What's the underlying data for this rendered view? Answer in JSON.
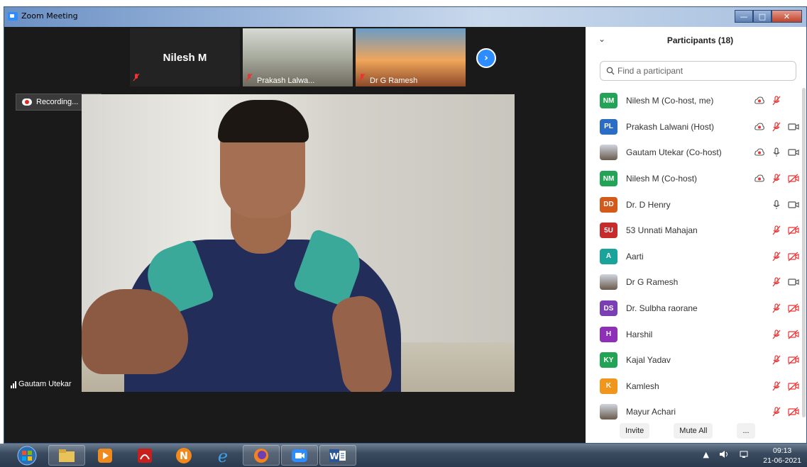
{
  "window": {
    "title": "Zoom Meeting",
    "minimize": "—",
    "maximize": "□",
    "close": "✕"
  },
  "stage": {
    "thumbnails": [
      {
        "big_name": "Nilesh M",
        "label": ""
      },
      {
        "label": "Prakash Lalwa..."
      },
      {
        "label": "Dr G Ramesh"
      }
    ],
    "next_icon": "›",
    "recording": "Recording...",
    "active_speaker": "Gautam Utekar"
  },
  "panel": {
    "collapse_icon": "⌄",
    "title": "Participants (18)",
    "search_placeholder": "Find a participant",
    "participants": [
      {
        "initials": "NM",
        "color": "#23a356",
        "name": "Nilesh M (Co-host, me)",
        "rec": true,
        "mic": "muted",
        "video": "none"
      },
      {
        "initials": "PL",
        "color": "#2b6cc4",
        "name": "Prakash Lalwani (Host)",
        "rec": true,
        "mic": "muted",
        "video": "on"
      },
      {
        "initials": "",
        "color": "#dfe8f0",
        "name": "Gautam Utekar (Co-host)",
        "rec": true,
        "mic": "on",
        "video": "on",
        "photo": true
      },
      {
        "initials": "NM",
        "color": "#23a356",
        "name": "Nilesh M (Co-host)",
        "rec": true,
        "mic": "muted",
        "video": "off"
      },
      {
        "initials": "DD",
        "color": "#d45a1c",
        "name": "Dr. D Henry",
        "rec": false,
        "mic": "on",
        "video": "on"
      },
      {
        "initials": "5U",
        "color": "#c62c2c",
        "name": "53 Unnati Mahajan",
        "rec": false,
        "mic": "muted",
        "video": "off"
      },
      {
        "initials": "A",
        "color": "#1aa39a",
        "name": "Aarti",
        "rec": false,
        "mic": "muted",
        "video": "off"
      },
      {
        "initials": "",
        "color": "#7a5a3a",
        "name": "Dr G Ramesh",
        "rec": false,
        "mic": "muted",
        "video": "on",
        "photo": true
      },
      {
        "initials": "DS",
        "color": "#7b3fb5",
        "name": "Dr. Sulbha raorane",
        "rec": false,
        "mic": "muted",
        "video": "off"
      },
      {
        "initials": "H",
        "color": "#8e2fb8",
        "name": "Harshil",
        "rec": false,
        "mic": "muted",
        "video": "off"
      },
      {
        "initials": "KY",
        "color": "#23a356",
        "name": "Kajal Yadav",
        "rec": false,
        "mic": "muted",
        "video": "off"
      },
      {
        "initials": "K",
        "color": "#f0961c",
        "name": "Kamlesh",
        "rec": false,
        "mic": "muted",
        "video": "off"
      },
      {
        "initials": "",
        "color": "#9bb1c8",
        "name": "Mayur Achari",
        "rec": false,
        "mic": "muted",
        "video": "off",
        "photo": true
      }
    ],
    "footer": {
      "invite": "Invite",
      "mute_all": "Mute All",
      "more": "..."
    }
  },
  "taskbar": {
    "time": "09:13",
    "date": "21-06-2021",
    "tray_expand": "▲"
  }
}
